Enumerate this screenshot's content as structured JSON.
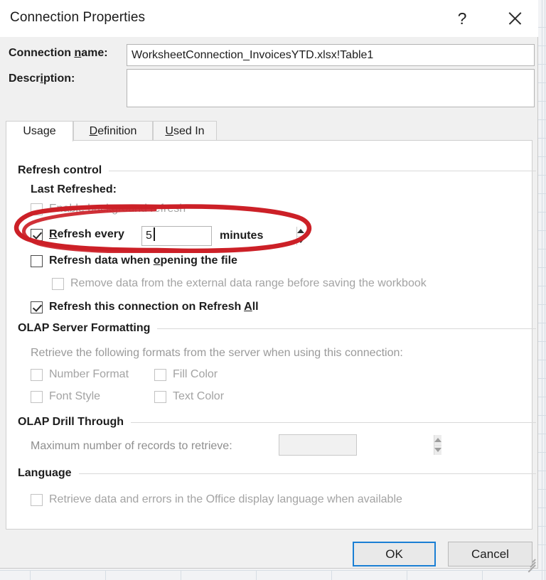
{
  "window": {
    "title": "Connection Properties",
    "help_icon": "question-mark-icon",
    "close_icon": "close-x-icon"
  },
  "header": {
    "connection_name_label": "Connection name:",
    "connection_name_accel": "n",
    "connection_name_value": "WorksheetConnection_InvoicesYTD.xlsx!Table1",
    "description_label": "Description:",
    "description_value": ""
  },
  "tabs": [
    {
      "label": "Usage",
      "accel": "g",
      "active": true
    },
    {
      "label": "Definition",
      "accel": "D",
      "active": false
    },
    {
      "label": "Used In",
      "accel": "U",
      "active": false
    }
  ],
  "usage": {
    "refresh_control": {
      "group_title": "Refresh control",
      "last_refreshed_label": "Last Refreshed:",
      "enable_background_refresh": {
        "label": "Enable background refresh",
        "accel": "B",
        "checked": false,
        "enabled": false
      },
      "refresh_every": {
        "label": "Refresh every",
        "accel": "R",
        "checked": true,
        "enabled": true,
        "value": "5",
        "unit_label": "minutes",
        "spinner_up_icon": "triangle-up-icon",
        "spinner_down_icon": "triangle-down-icon"
      },
      "refresh_on_open": {
        "label": "Refresh data when opening the file",
        "accel": "o",
        "checked": false,
        "enabled": true
      },
      "remove_data_before_save": {
        "label": "Remove data from the external data range before saving the workbook",
        "checked": false,
        "enabled": false
      },
      "refresh_on_refresh_all": {
        "label": "Refresh this connection on Refresh All",
        "accel": "A",
        "checked": true,
        "enabled": true
      }
    },
    "olap_server_formatting": {
      "group_title": "OLAP Server Formatting",
      "description": "Retrieve the following formats from the server when using this connection:",
      "options": [
        {
          "label": "Number Format",
          "checked": false,
          "enabled": false
        },
        {
          "label": "Fill Color",
          "checked": false,
          "enabled": false
        },
        {
          "label": "Font Style",
          "checked": false,
          "enabled": false
        },
        {
          "label": "Text Color",
          "checked": false,
          "enabled": false
        }
      ]
    },
    "olap_drill_through": {
      "group_title": "OLAP Drill Through",
      "max_records_label": "Maximum number of records to retrieve:",
      "max_records_value": "",
      "enabled": false,
      "spinner_up_icon": "triangle-up-icon",
      "spinner_down_icon": "triangle-down-icon"
    },
    "language": {
      "group_title": "Language",
      "option": {
        "label": "Retrieve data and errors in the Office display language when available",
        "checked": false,
        "enabled": false
      }
    }
  },
  "footer": {
    "ok_label": "OK",
    "cancel_label": "Cancel"
  },
  "annotation": {
    "type": "hand-drawn-ellipse",
    "color": "#cc2027",
    "targets": "Refresh every 5 minutes"
  },
  "colors": {
    "dialog_bg": "#f0f0f0",
    "panel_bg": "#ffffff",
    "focus_border": "#1b7fd4",
    "annotation_red": "#cc2027",
    "disabled_text": "#a3a3a3"
  }
}
